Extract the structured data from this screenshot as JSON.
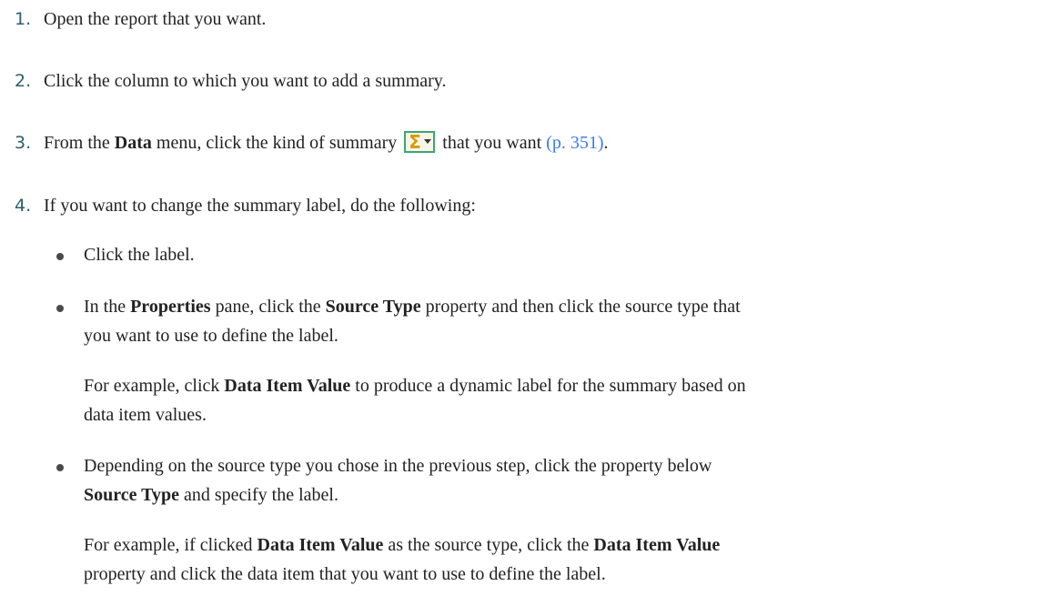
{
  "steps": [
    {
      "num": "1.",
      "text": "Open the report that you want."
    },
    {
      "num": "2.",
      "text": "Click the column to which you want to add a summary."
    },
    {
      "num": "3.",
      "t1": "From the ",
      "b1": "Data",
      "t2": " menu, click the kind of summary",
      "t3": "that you want ",
      "link": "(p. 351)",
      "t4": ".",
      "icon": "summarize-icon"
    },
    {
      "num": "4.",
      "text": "If you want to change the summary label, do the following:"
    }
  ],
  "bullets": [
    {
      "text": "Click the label."
    },
    {
      "t1": "In the ",
      "b1": "Properties",
      "t2": " pane, click the ",
      "b2": "Source Type",
      "t3": " property and then click the source type that",
      "line2": "you want to use to define the label.",
      "ex1_t1": "For example, click ",
      "ex1_b1": "Data Item Value",
      "ex1_t2": " to produce a dynamic label for the summary based on",
      "ex1_line2": "data item values."
    },
    {
      "t1": "Depending on the source type you chose in the previous step, click the property below",
      "line2_b": "Source Type",
      "line2_t": " and specify the label.",
      "ex1_t1": "For example, if clicked ",
      "ex1_b1": "Data Item Value",
      "ex1_t2": " as the source type, click the ",
      "ex1_b2": "Data Item Value",
      "ex1_line2": "property and click the data item that you want to use to define the label."
    }
  ]
}
